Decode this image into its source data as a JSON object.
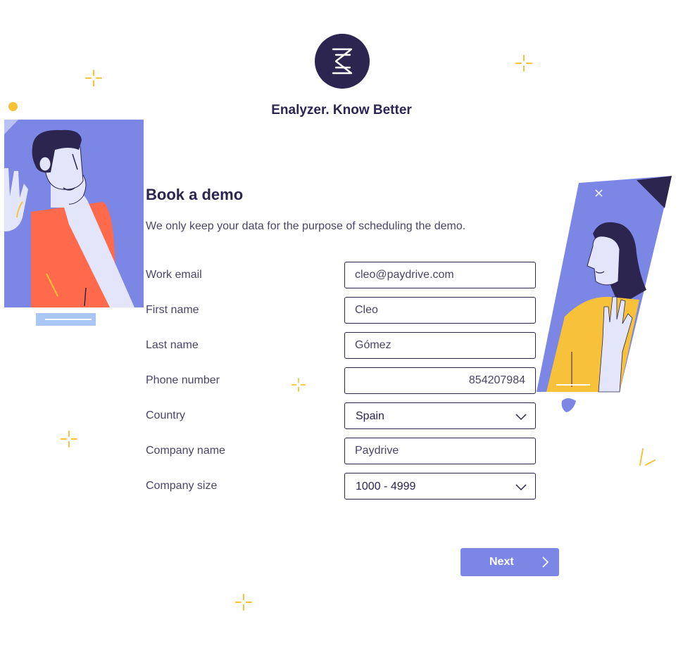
{
  "brand": {
    "tagline": "Enalyzer. Know Better",
    "logo_icon": "enalyzer-logo-icon"
  },
  "form": {
    "title": "Book a demo",
    "subtitle": "We only keep your data for the purpose of scheduling the demo.",
    "fields": [
      {
        "label": "Work email",
        "value": "cleo@paydrive.com"
      },
      {
        "label": "First name",
        "value": "Cleo"
      },
      {
        "label": "Last name",
        "value": "Gómez"
      },
      {
        "label": "Phone number",
        "value": "854207984"
      },
      {
        "label": "Country",
        "value": "Spain",
        "icon": "chevron-down-icon"
      },
      {
        "label": "Company name",
        "value": "Paydrive"
      },
      {
        "label": "Company size",
        "value": "1000 - 4999",
        "icon": "chevron-down-icon"
      }
    ],
    "next_label": "Next",
    "next_icon": "chevron-right-icon"
  },
  "colors": {
    "navy": "#2b2550",
    "accent": "#7b86e5",
    "yellow": "#f7c23a",
    "coral": "#ff6a4d",
    "lavender": "#e3e5fb"
  }
}
